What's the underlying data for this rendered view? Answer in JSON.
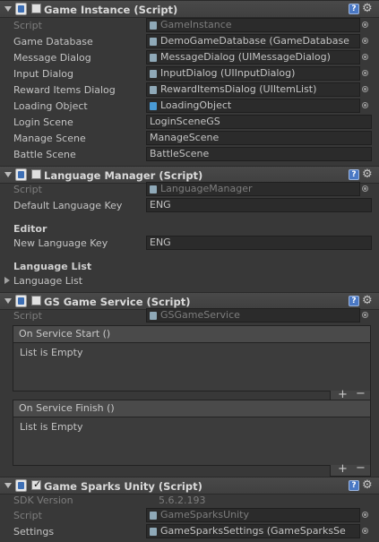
{
  "game_instance": {
    "title": "Game Instance (Script)",
    "script_label": "Script",
    "script_value": "GameInstance",
    "fields": [
      {
        "label": "Game Database",
        "value": "DemoGameDatabase (GameDatabase"
      },
      {
        "label": "Message Dialog",
        "value": "MessageDialog (UIMessageDialog)"
      },
      {
        "label": "Input Dialog",
        "value": "InputDialog (UIInputDialog)"
      },
      {
        "label": "Reward Items Dialog",
        "value": "RewardItemsDialog (UIItemList)"
      },
      {
        "label": "Loading Object",
        "value": "LoadingObject"
      }
    ],
    "scenes": [
      {
        "label": "Login Scene",
        "value": "LoginSceneGS"
      },
      {
        "label": "Manage Scene",
        "value": "ManageScene"
      },
      {
        "label": "Battle Scene",
        "value": "BattleScene"
      }
    ]
  },
  "language_manager": {
    "title": "Language Manager (Script)",
    "script_label": "Script",
    "script_value": "LanguageManager",
    "default_key_label": "Default Language Key",
    "default_key_value": "ENG",
    "editor_header": "Editor",
    "new_key_label": "New Language Key",
    "new_key_value": "ENG",
    "list_header": "Language List",
    "list_foldout": "Language List"
  },
  "gs_service": {
    "title": "GS Game Service (Script)",
    "script_label": "Script",
    "script_value": "GSGameService",
    "events": [
      {
        "name": "On Service Start ()",
        "empty": "List is Empty"
      },
      {
        "name": "On Service Finish ()",
        "empty": "List is Empty"
      }
    ],
    "plus": "+",
    "minus": "−"
  },
  "game_sparks": {
    "title": "Game Sparks Unity (Script)",
    "enabled": true,
    "check": "✓",
    "sdk_label": "SDK Version",
    "sdk_value": "5.6.2.193",
    "script_label": "Script",
    "script_value": "GameSparksUnity",
    "settings_label": "Settings",
    "settings_value": "GameSparksSettings (GameSparksSe"
  },
  "icons": {
    "help": "?",
    "gear": "⚙"
  }
}
